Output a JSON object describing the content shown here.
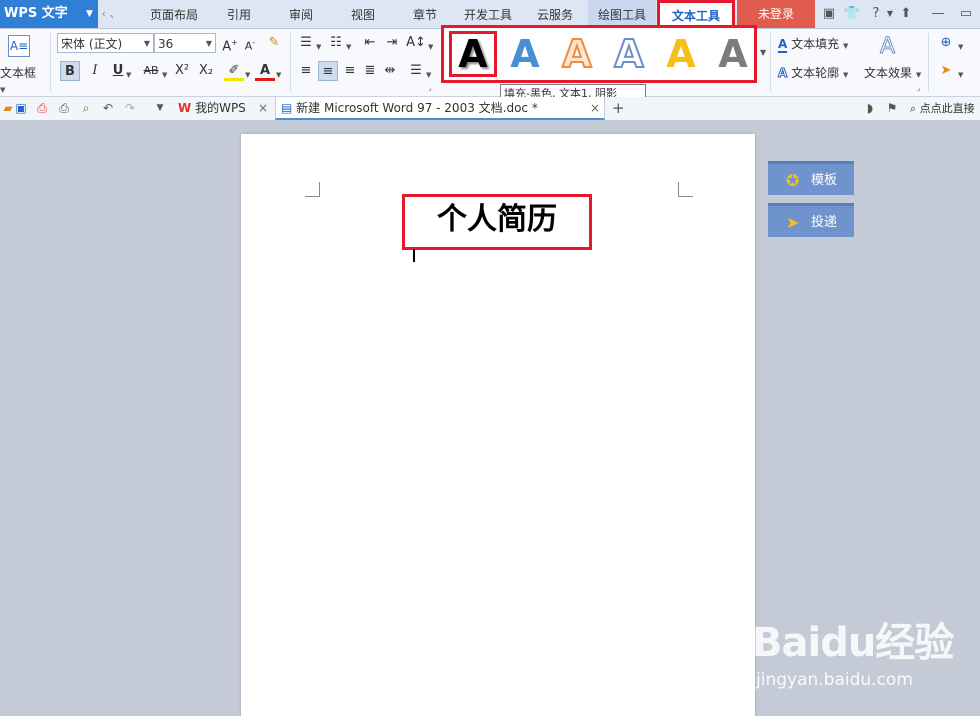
{
  "app": {
    "name": "WPS 文字"
  },
  "menu_tabs": [
    "页面布局",
    "引用",
    "审阅",
    "视图",
    "章节",
    "开发工具",
    "云服务",
    "绘图工具",
    "文本工具"
  ],
  "login": "未登录",
  "ribbon": {
    "textbox_label": "文本框",
    "font_name": "宋体 (正文)",
    "font_size": "36",
    "bold": "B",
    "italic": "I",
    "underline": "U",
    "strike": "AB",
    "superscript": "X²",
    "subscript": "X₂",
    "font_color": "A",
    "text_fill": "文本填充",
    "text_outline": "文本轮廓",
    "text_effect": "文本效果"
  },
  "gallery": {
    "letter": "A",
    "styles": [
      {
        "name": "fill-black",
        "color": "#000000"
      },
      {
        "name": "fill-blue",
        "color": "#4a8fd4"
      },
      {
        "name": "outline-orange",
        "color": "#f08a3c"
      },
      {
        "name": "outline-blue",
        "color": "#6d8fc7"
      },
      {
        "name": "fill-gold",
        "color": "#f5be19"
      },
      {
        "name": "fill-gray",
        "color": "#7b7b7b"
      }
    ]
  },
  "tooltip": "填充-黑色, 文本1, 阴影",
  "doc_tabs": [
    {
      "label": "我的WPS"
    },
    {
      "label": "新建 Microsoft Word 97 - 2003 文档.doc *"
    }
  ],
  "search_hint": "点点此直接",
  "document": {
    "title": "个人简历"
  },
  "side_buttons": {
    "template": "模板",
    "submit": "投递"
  },
  "watermark": {
    "brand": "Baidu经验",
    "url": "jingyan.baidu.com"
  },
  "colors": {
    "accent": "#2f7fd6",
    "highlight": "#e5192b",
    "login_bg": "#e15b4e"
  }
}
